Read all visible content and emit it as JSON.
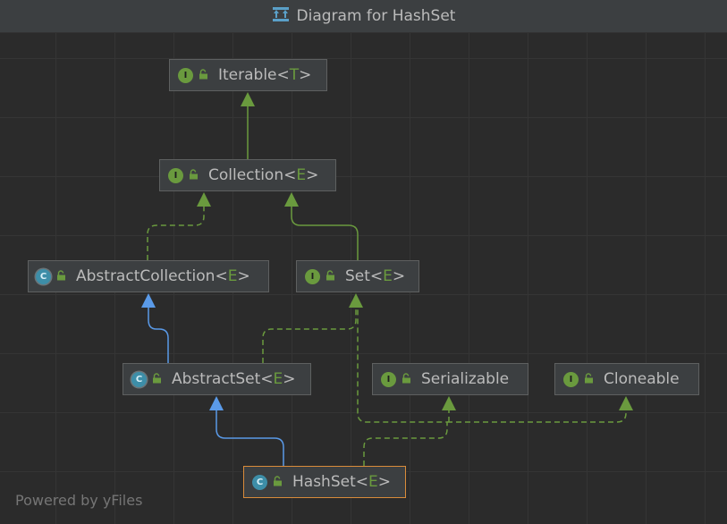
{
  "window": {
    "title": "Diagram for HashSet",
    "footer": "Powered by yFiles"
  },
  "nodes": {
    "iterable": {
      "kind": "interface",
      "badge": "I",
      "name": "Iterable",
      "lt": "<",
      "param": "T",
      "gt": ">"
    },
    "collection": {
      "kind": "interface",
      "badge": "I",
      "name": "Collection",
      "lt": "<",
      "param": "E",
      "gt": ">"
    },
    "abstract_collection": {
      "kind": "abstract-class",
      "badge": "C",
      "name": "AbstractCollection",
      "lt": "<",
      "param": "E",
      "gt": ">"
    },
    "set": {
      "kind": "interface",
      "badge": "I",
      "name": "Set",
      "lt": "<",
      "param": "E",
      "gt": ">"
    },
    "abstract_set": {
      "kind": "abstract-class",
      "badge": "C",
      "name": "AbstractSet",
      "lt": "<",
      "param": "E",
      "gt": ">"
    },
    "serializable": {
      "kind": "interface",
      "badge": "I",
      "name": "Serializable"
    },
    "cloneable": {
      "kind": "interface",
      "badge": "I",
      "name": "Cloneable"
    },
    "hashset": {
      "kind": "class",
      "badge": "C",
      "name": "HashSet",
      "lt": "<",
      "param": "E",
      "gt": ">",
      "selected": true
    }
  },
  "edges": [
    {
      "from": "collection",
      "to": "iterable",
      "relation": "extends",
      "style": "solid-green"
    },
    {
      "from": "abstract_collection",
      "to": "collection",
      "relation": "implements",
      "style": "dashed-green"
    },
    {
      "from": "set",
      "to": "collection",
      "relation": "extends",
      "style": "solid-green"
    },
    {
      "from": "abstract_set",
      "to": "abstract_collection",
      "relation": "extends",
      "style": "solid-blue"
    },
    {
      "from": "abstract_set",
      "to": "set",
      "relation": "implements",
      "style": "dashed-green"
    },
    {
      "from": "hashset",
      "to": "abstract_set",
      "relation": "extends",
      "style": "solid-blue"
    },
    {
      "from": "hashset",
      "to": "set",
      "relation": "implements",
      "style": "dashed-green"
    },
    {
      "from": "hashset",
      "to": "serializable",
      "relation": "implements",
      "style": "dashed-green"
    },
    {
      "from": "hashset",
      "to": "cloneable",
      "relation": "implements",
      "style": "dashed-green"
    }
  ],
  "colors": {
    "background": "#2b2b2b",
    "node_fill": "#3c3f41",
    "node_border": "#5e6060",
    "selected_border": "#d98b3a",
    "interface_edge": "#6a9a3e",
    "class_edge": "#5a9ae8",
    "type_param": "#6a9a3e"
  }
}
